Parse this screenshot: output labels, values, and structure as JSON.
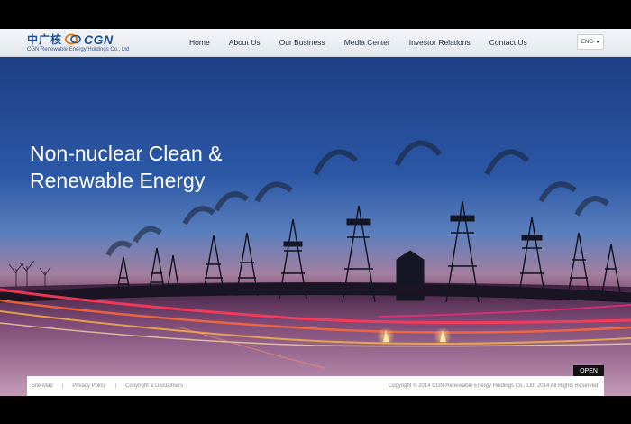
{
  "brand": {
    "cn": "中广核",
    "en": "CGN",
    "company": "CGN Renewable Energy Holdings Co., Ltd"
  },
  "nav": {
    "items": [
      "Home",
      "About Us",
      "Our Business",
      "Media Center",
      "Investor Relations",
      "Contact Us"
    ]
  },
  "language": {
    "selected": "ENG"
  },
  "hero": {
    "line1": "Non-nuclear Clean &",
    "line2": "Renewable Energy"
  },
  "footer": {
    "links": [
      "Site Map",
      "Privacy Policy",
      "Copyright & Disclaimers"
    ],
    "separator": "|",
    "copyright": "Copyright © 2014 CGN Renewable Energy Holdings Co., Ltd. 2014 All Rights Reserved."
  },
  "open_button": "OPEN",
  "colors": {
    "brand_blue": "#1d4f91",
    "header_bg": "#eef1f5",
    "sky": "#2b58a6"
  }
}
